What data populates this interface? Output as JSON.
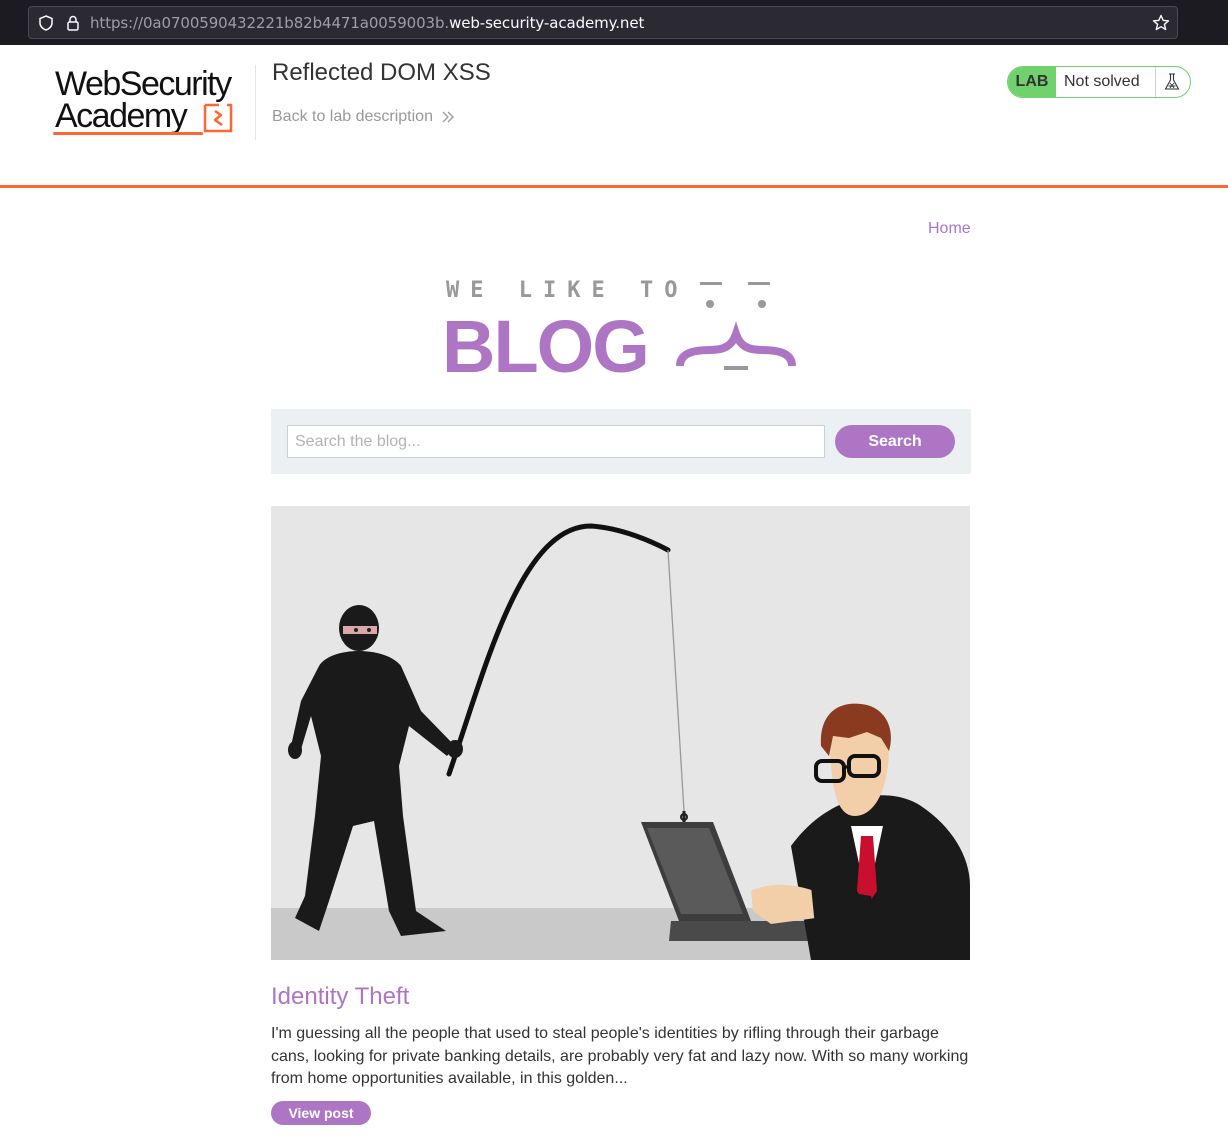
{
  "browser": {
    "url_dim": "https://0a0700590432221b82b4471a0059003b.",
    "url_host": "web-security-academy.net"
  },
  "academy": {
    "logo_line1": "WebSecurity",
    "logo_line2": "Academy",
    "lab_title": "Reflected DOM XSS",
    "back_link": "Back to lab description",
    "status_badge": "LAB",
    "status_text": "Not solved"
  },
  "nav": {
    "home": "Home"
  },
  "blog_logo": {
    "tagline": "WE LIKE TO",
    "word": "BLOG"
  },
  "search": {
    "placeholder": "Search the blog...",
    "button": "Search"
  },
  "post": {
    "title": "Identity Theft",
    "summary": "I'm guessing all the people that used to steal people's identities by rifling through their garbage cans, looking for private banking details, are probably very fat and lazy now. With so many working from home opportunities available, in this golden...",
    "button": "View post"
  },
  "colors": {
    "accent": "#ae75c5",
    "orange": "#ff6633",
    "status_green": "#70d16d"
  },
  "icons": [
    "shield-icon",
    "lock-icon",
    "star-icon",
    "chevron-right-icon",
    "flask-icon"
  ]
}
